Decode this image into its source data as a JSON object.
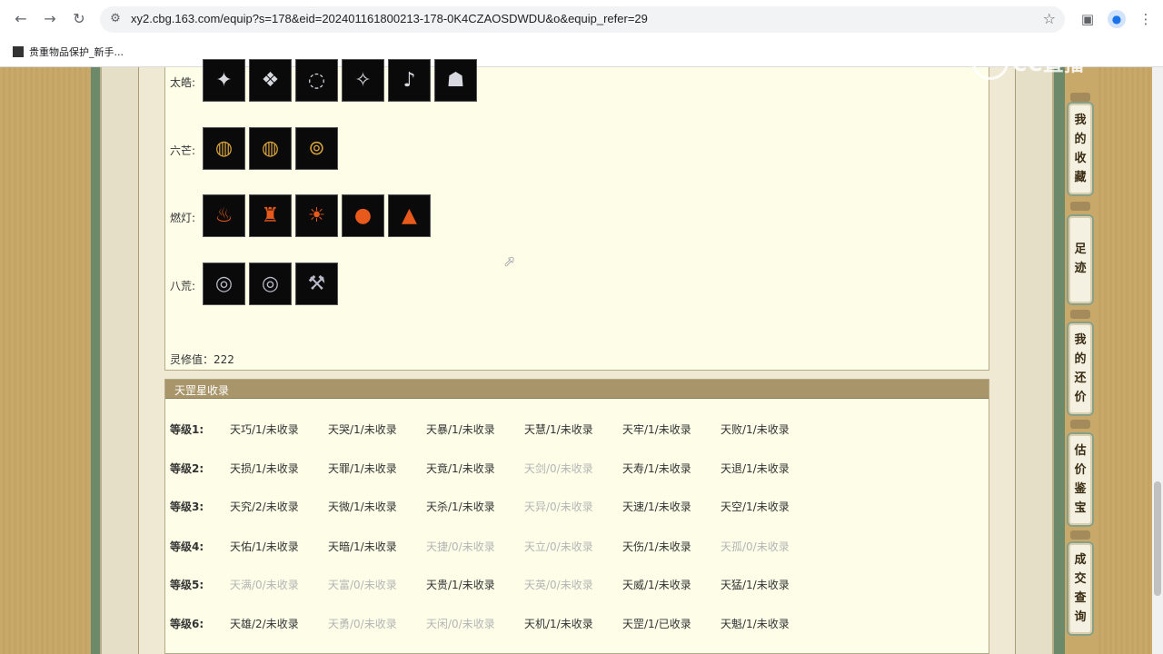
{
  "browser": {
    "url": "xy2.cbg.163.com/equip?s=178&eid=202401161800213-178-0K4CZAOSDWDU&o&equip_refer=29",
    "bookmark": "贵重物品保护_新手..."
  },
  "watermark": "CC直播",
  "items_panel": {
    "rows": [
      {
        "label": "太皓:",
        "items": [
          "silver",
          "silver",
          "silver",
          "silver",
          "silver",
          "silver"
        ]
      },
      {
        "label": "六芒:",
        "items": [
          "gold",
          "gold",
          "gold"
        ]
      },
      {
        "label": "燃灯:",
        "items": [
          "fire",
          "fire",
          "fire",
          "fire",
          "fire"
        ]
      },
      {
        "label": "八荒:",
        "items": [
          "ring",
          "ring",
          "ring"
        ]
      }
    ],
    "lingxiu": "灵修值：222"
  },
  "tiangang": {
    "title": "天罡星收录",
    "levels": [
      {
        "label": "等级1:",
        "cells": [
          {
            "text": "天巧/1/未收录",
            "dim": false
          },
          {
            "text": "天哭/1/未收录",
            "dim": false
          },
          {
            "text": "天暴/1/未收录",
            "dim": false
          },
          {
            "text": "天慧/1/未收录",
            "dim": false
          },
          {
            "text": "天牢/1/未收录",
            "dim": false
          },
          {
            "text": "天败/1/未收录",
            "dim": false
          }
        ]
      },
      {
        "label": "等级2:",
        "cells": [
          {
            "text": "天损/1/未收录",
            "dim": false
          },
          {
            "text": "天罪/1/未收录",
            "dim": false
          },
          {
            "text": "天竟/1/未收录",
            "dim": false
          },
          {
            "text": "天剑/0/未收录",
            "dim": true
          },
          {
            "text": "天寿/1/未收录",
            "dim": false
          },
          {
            "text": "天退/1/未收录",
            "dim": false
          }
        ]
      },
      {
        "label": "等级3:",
        "cells": [
          {
            "text": "天究/2/未收录",
            "dim": false
          },
          {
            "text": "天微/1/未收录",
            "dim": false
          },
          {
            "text": "天杀/1/未收录",
            "dim": false
          },
          {
            "text": "天异/0/未收录",
            "dim": true
          },
          {
            "text": "天速/1/未收录",
            "dim": false
          },
          {
            "text": "天空/1/未收录",
            "dim": false
          }
        ]
      },
      {
        "label": "等级4:",
        "cells": [
          {
            "text": "天佑/1/未收录",
            "dim": false
          },
          {
            "text": "天暗/1/未收录",
            "dim": false
          },
          {
            "text": "天捷/0/未收录",
            "dim": true
          },
          {
            "text": "天立/0/未收录",
            "dim": true
          },
          {
            "text": "天伤/1/未收录",
            "dim": false
          },
          {
            "text": "天孤/0/未收录",
            "dim": true
          }
        ]
      },
      {
        "label": "等级5:",
        "cells": [
          {
            "text": "天满/0/未收录",
            "dim": true
          },
          {
            "text": "天富/0/未收录",
            "dim": true
          },
          {
            "text": "天贵/1/未收录",
            "dim": false
          },
          {
            "text": "天英/0/未收录",
            "dim": true
          },
          {
            "text": "天威/1/未收录",
            "dim": false
          },
          {
            "text": "天猛/1/未收录",
            "dim": false
          }
        ]
      },
      {
        "label": "等级6:",
        "cells": [
          {
            "text": "天雄/2/未收录",
            "dim": false
          },
          {
            "text": "天勇/0/未收录",
            "dim": true
          },
          {
            "text": "天闲/0/未收录",
            "dim": true
          },
          {
            "text": "天机/1/未收录",
            "dim": false
          },
          {
            "text": "天罡/1/已收录",
            "dim": false
          },
          {
            "text": "天魁/1/未收录",
            "dim": false
          }
        ]
      }
    ]
  },
  "rail": [
    {
      "label": "我的收藏",
      "chars": [
        "我",
        "的",
        "收",
        "藏"
      ]
    },
    {
      "label": "足迹",
      "chars": [
        "足",
        "迹"
      ]
    },
    {
      "label": "我的还价",
      "chars": [
        "我",
        "的",
        "还",
        "价"
      ]
    },
    {
      "label": "估价鉴宝",
      "chars": [
        "估",
        "价",
        "鉴",
        "宝"
      ]
    },
    {
      "label": "成交查询",
      "chars": [
        "成",
        "交",
        "查",
        "询"
      ]
    }
  ]
}
